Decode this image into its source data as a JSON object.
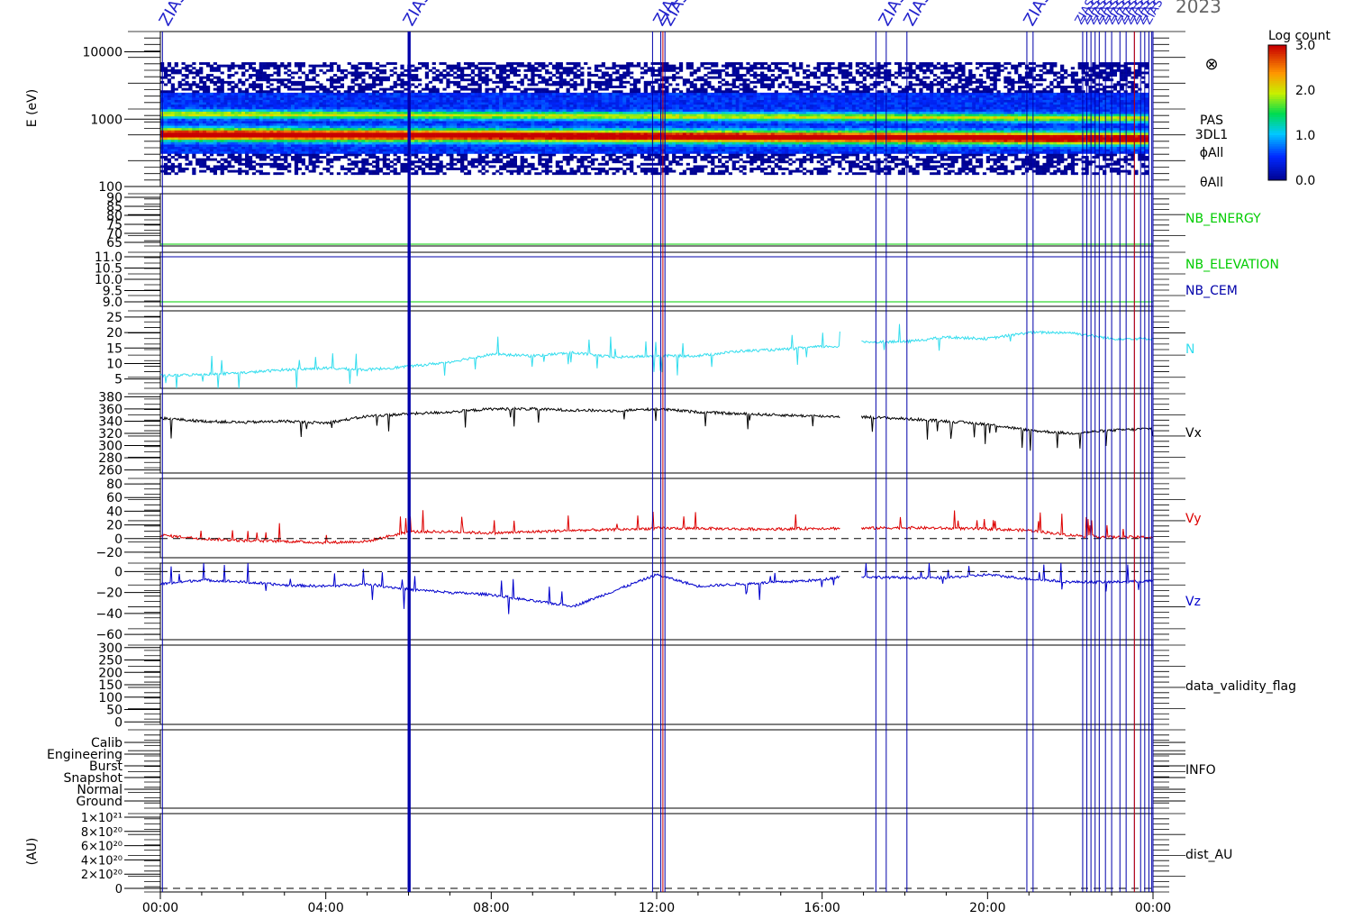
{
  "header": {
    "year": "2023"
  },
  "colorbar": {
    "title": "Log count",
    "ticks": [
      "3.0",
      "2.0",
      "1.0",
      "0.0"
    ]
  },
  "spectrogram": {
    "ylabel": "E (eV)",
    "y_ticks": [
      "10000",
      "1000",
      "100"
    ],
    "right_labels": [
      "PAS",
      "3DL1",
      "ϕAll",
      "θAll"
    ],
    "symbol": "⊗"
  },
  "x_ticks": [
    "00:00",
    "04:00",
    "08:00",
    "12:00",
    "16:00",
    "20:00",
    "00:00"
  ],
  "dist_ylabel": "(AU)",
  "event_labels": {
    "text": "ZIAS",
    "times_hours": [
      0.1,
      6.0,
      12.05,
      12.25,
      17.5,
      18.1,
      21.0
    ]
  },
  "colors": {
    "axis": "#000000",
    "energy": "#00cc00",
    "cem": "#0000aa",
    "n": "#33ddee",
    "vx": "#000000",
    "vy": "#dd0000",
    "vz": "#0000cc",
    "event_line": "#0000aa",
    "event_label": "#2222cc"
  },
  "chart_data": [
    {
      "type": "heatmap",
      "label": "PAS 3DL1",
      "ylabel": "E (eV)",
      "yscale": "log",
      "ylim": [
        100,
        20000
      ],
      "clim": [
        0.0,
        3.0
      ],
      "clabel": "Log count",
      "x_range_hours": [
        0,
        24
      ]
    },
    {
      "type": "line",
      "label": "NB_ENERGY",
      "y_ticks": [
        "90",
        "85",
        "80",
        "75",
        "70",
        "65"
      ],
      "ylim": [
        63,
        92
      ],
      "series": [
        {
          "name": "NB_ENERGY",
          "x": [
            0,
            24
          ],
          "values": [
            64,
            64
          ]
        }
      ]
    },
    {
      "type": "line",
      "label": "NB_ELEVATION / NB_CEM",
      "labels": [
        "NB_ELEVATION",
        "NB_CEM"
      ],
      "y_ticks": [
        "11.0",
        "10.5",
        "10.0",
        "9.5",
        "9.0"
      ],
      "ylim": [
        8.8,
        11.2
      ],
      "series": [
        {
          "name": "NB_ELEVATION",
          "x": [
            0,
            24
          ],
          "values": [
            9.0,
            9.0
          ]
        },
        {
          "name": "NB_CEM",
          "x": [
            0,
            24
          ],
          "values": [
            11.0,
            11.0
          ]
        }
      ]
    },
    {
      "type": "line",
      "label": "N",
      "y_ticks": [
        "25",
        "20",
        "15",
        "10",
        "5"
      ],
      "ylim": [
        2,
        27
      ],
      "series": [
        {
          "name": "N",
          "x": [
            0,
            1,
            2,
            3,
            4,
            5,
            6,
            7,
            8,
            9,
            10,
            11,
            12,
            13,
            14,
            15,
            16,
            16.4,
            17,
            18,
            19,
            20,
            21,
            22,
            23,
            24
          ],
          "values": [
            6,
            6.5,
            7,
            8,
            8.5,
            8,
            9,
            10.5,
            13,
            12.5,
            13.5,
            12,
            12.5,
            12.5,
            14,
            14.5,
            15.5,
            15.5,
            17,
            17,
            18.5,
            18,
            20,
            20,
            18,
            18
          ]
        }
      ]
    },
    {
      "type": "line",
      "label": "Vx",
      "y_ticks": [
        "380",
        "360",
        "340",
        "320",
        "300",
        "280",
        "260"
      ],
      "ylim": [
        255,
        385
      ],
      "series": [
        {
          "name": "Vx",
          "x": [
            0,
            1,
            2,
            3,
            4,
            5,
            6,
            7,
            8,
            9,
            10,
            11,
            12,
            13,
            14,
            15,
            16,
            16.4,
            17,
            18,
            19,
            20,
            21,
            22,
            23,
            24
          ],
          "values": [
            345,
            340,
            338,
            340,
            337,
            348,
            352,
            355,
            360,
            360,
            358,
            357,
            360,
            355,
            352,
            350,
            348,
            348,
            347,
            344,
            340,
            335,
            325,
            320,
            325,
            328
          ]
        }
      ]
    },
    {
      "type": "line",
      "label": "Vy",
      "y_ticks": [
        "80",
        "60",
        "40",
        "20",
        "0",
        "−20"
      ],
      "ylim": [
        -28,
        88
      ],
      "series": [
        {
          "name": "Vy",
          "x": [
            0,
            1,
            2,
            3,
            4,
            5,
            6,
            7,
            8,
            9,
            10,
            11,
            12,
            13,
            14,
            15,
            16,
            16.4,
            17,
            18,
            19,
            20,
            21,
            22,
            23,
            24
          ],
          "values": [
            5,
            0,
            -3,
            -4,
            -6,
            -4,
            10,
            10,
            8,
            10,
            12,
            13,
            15,
            15,
            14,
            14,
            15,
            15,
            15,
            16,
            15,
            14,
            12,
            5,
            2,
            2
          ]
        }
      ]
    },
    {
      "type": "line",
      "label": "Vz",
      "y_ticks": [
        "0",
        "−20",
        "−40",
        "−60"
      ],
      "ylim": [
        -65,
        8
      ],
      "series": [
        {
          "name": "Vz",
          "x": [
            0,
            1,
            2,
            3,
            4,
            5,
            6,
            7,
            8,
            9,
            10,
            11,
            12,
            13,
            14,
            15,
            16,
            16.4,
            17,
            18,
            19,
            20,
            21,
            22,
            23,
            24
          ],
          "values": [
            -12,
            -8,
            -10,
            -13,
            -14,
            -12,
            -17,
            -20,
            -22,
            -28,
            -33,
            -18,
            -3,
            -14,
            -12,
            -10,
            -8,
            -5,
            -5,
            -6,
            -6,
            -3,
            -7,
            -10,
            -10,
            -9
          ]
        }
      ]
    },
    {
      "type": "line",
      "label": "data_validity_flag",
      "y_ticks": [
        "300",
        "250",
        "200",
        "150",
        "100",
        "50",
        "0"
      ],
      "ylim": [
        -10,
        310
      ],
      "series": []
    },
    {
      "type": "line",
      "label": "INFO",
      "y_ticks": [
        "Calib",
        "Engineering",
        "Burst",
        "Snapshot",
        "Normal",
        "Ground"
      ],
      "series": []
    },
    {
      "type": "line",
      "label": "dist_AU",
      "ylabel": "(AU)",
      "y_ticks": [
        "1×10²¹",
        "8×10²⁰",
        "6×10²⁰",
        "4×10²⁰",
        "2×10²⁰",
        "0"
      ],
      "ylim": [
        -5e+19,
        1.05e+21
      ],
      "series": []
    }
  ]
}
